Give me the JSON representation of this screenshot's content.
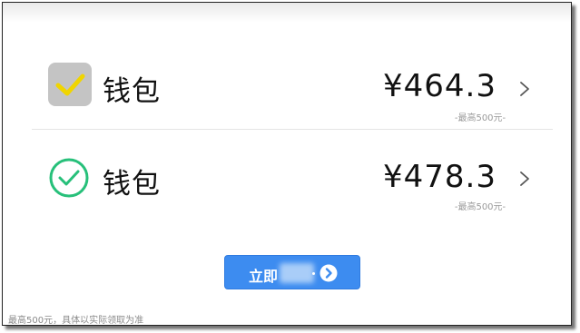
{
  "options": [
    {
      "label": "钱包",
      "amount": "¥464.3",
      "max_note": "-最高500元-",
      "selector_icon": "checkbox-checked-icon",
      "check_color": "#f0d500"
    },
    {
      "label": "钱包",
      "amount": "¥478.3",
      "max_note": "-最高500元-",
      "selector_icon": "circle-check-icon",
      "check_color": "#27c07a"
    }
  ],
  "cta": {
    "label": "立即",
    "icon": "arrow-right-circle-icon",
    "color": "#3d8cf0"
  },
  "footnote": "最高500元，具体以实际领取为准"
}
